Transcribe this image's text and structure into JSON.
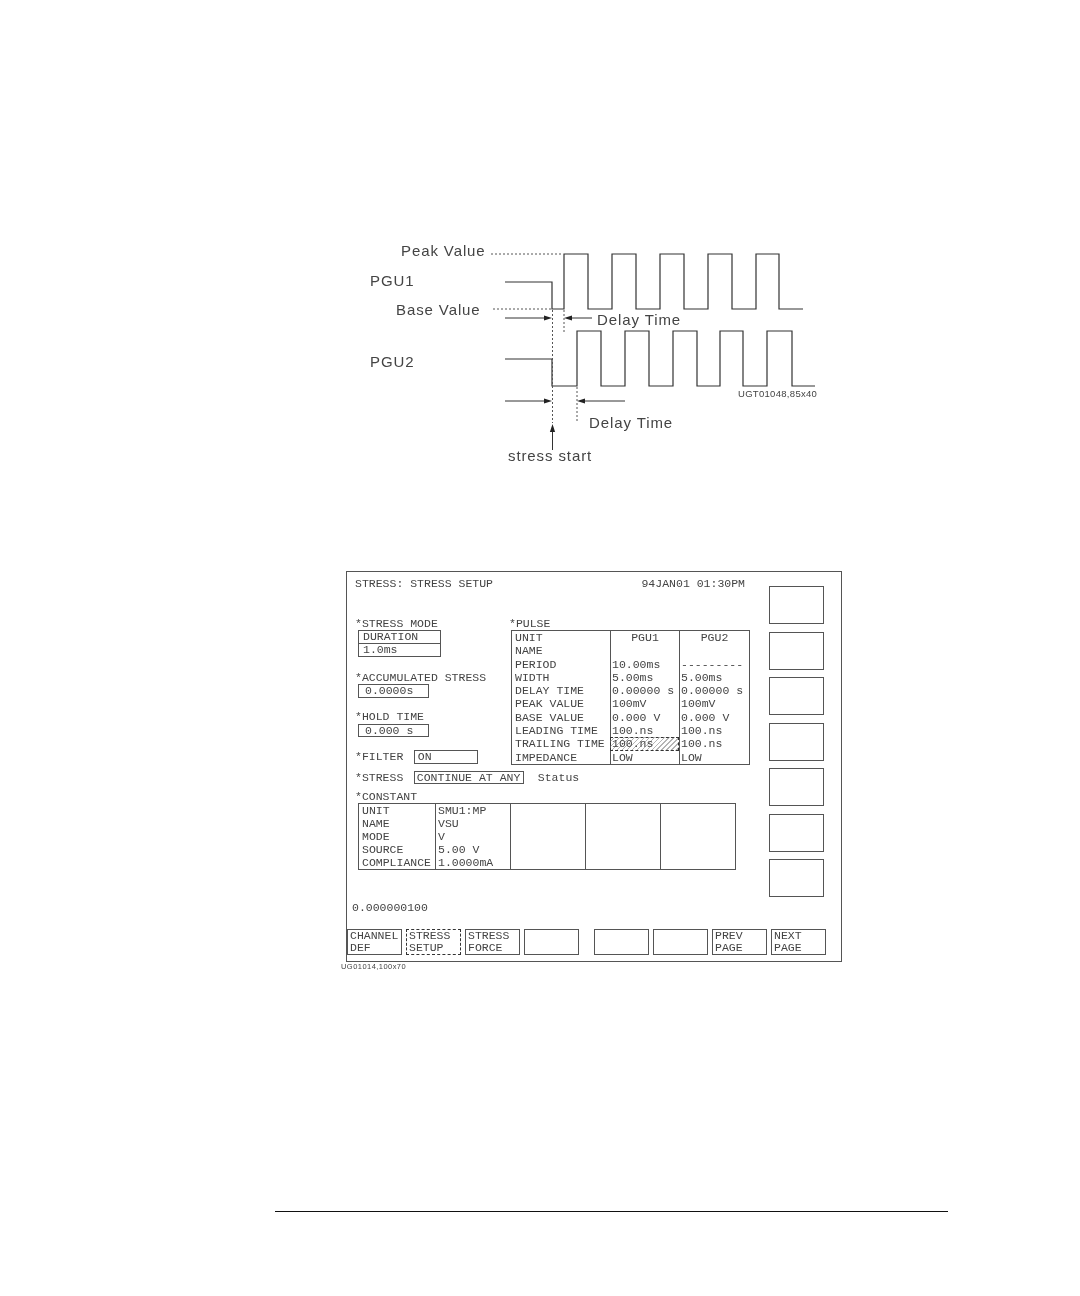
{
  "timing_diagram": {
    "peak_label": "Peak Value",
    "base_label": "Base Value",
    "channels": [
      {
        "name": "PGU1",
        "delay_label": "Delay Time"
      },
      {
        "name": "PGU2",
        "delay_label": "Delay Time"
      }
    ],
    "start_label": "stress start",
    "figure_id": "UGT01048,85x40"
  },
  "screen": {
    "title": "STRESS: STRESS SETUP",
    "datetime": "94JAN01 01:30PM",
    "stress_mode": {
      "label": "*STRESS MODE",
      "values": [
        "DURATION",
        "1.0ms"
      ]
    },
    "accumulated_stress": {
      "label": "*ACCUMULATED STRESS",
      "value": "0.0000s"
    },
    "hold_time": {
      "label": "*HOLD TIME",
      "value": "0.000 s"
    },
    "filter": {
      "label": "*FILTER",
      "value": "ON"
    },
    "pulse": {
      "label": "*PULSE",
      "columns": [
        "UNIT",
        "PGU1",
        "PGU2"
      ],
      "rows": [
        {
          "label": "NAME"
        },
        {
          "label": "PERIOD",
          "values": [
            {
              "text": "10.00ms",
              "selected": false
            },
            {
              "text": "---------",
              "selected": false
            }
          ]
        },
        {
          "label": "WIDTH",
          "values": [
            {
              "text": "5.00ms",
              "selected": false
            },
            {
              "text": "5.00ms",
              "selected": false
            }
          ]
        },
        {
          "label": "DELAY TIME",
          "values": [
            {
              "text": "0.00000 s",
              "selected": false
            },
            {
              "text": "0.00000 s",
              "selected": false
            }
          ]
        },
        {
          "label": "PEAK VALUE",
          "values": [
            {
              "text": "100mV",
              "selected": false
            },
            {
              "text": "100mV",
              "selected": false
            }
          ]
        },
        {
          "label": "BASE VALUE",
          "values": [
            {
              "text": "0.000 V",
              "selected": false
            },
            {
              "text": "0.000 V",
              "selected": false
            }
          ]
        },
        {
          "label": "LEADING TIME",
          "values": [
            {
              "text": "100.ns",
              "selected": false
            },
            {
              "text": "100.ns",
              "selected": false
            }
          ]
        },
        {
          "label": "TRAILING TIME",
          "values": [
            {
              "text": "100.ns",
              "selected": true
            },
            {
              "text": "100.ns",
              "selected": false
            }
          ]
        },
        {
          "label": "IMPEDANCE",
          "values": [
            {
              "text": "LOW",
              "selected": false
            },
            {
              "text": "LOW",
              "selected": false
            }
          ]
        }
      ]
    },
    "stress": {
      "label": "*STRESS",
      "value": "CONTINUE AT ANY",
      "note": "Status"
    },
    "constant": {
      "label": "*CONSTANT",
      "rows": [
        "UNIT",
        "NAME",
        "MODE",
        "SOURCE",
        "COMPLIANCE"
      ],
      "columns": [
        {
          "kind": "channel",
          "values": [
            "SMU1:MP",
            "VSU",
            "V",
            "5.00 V",
            "1.0000mA"
          ]
        },
        {
          "kind": "empty"
        },
        {
          "kind": "empty"
        },
        {
          "kind": "empty"
        }
      ]
    },
    "entry": "0.000000100",
    "side_keys": [
      {
        "kind": "blank"
      },
      {
        "kind": "blank"
      },
      {
        "kind": "blank"
      },
      {
        "kind": "blank"
      },
      {
        "kind": "blank"
      },
      {
        "kind": "blank"
      },
      {
        "kind": "blank"
      }
    ],
    "softkeys": [
      {
        "lines": [
          "CHANNEL",
          "DEF"
        ],
        "selected": false
      },
      {
        "lines": [
          "STRESS",
          "SETUP"
        ],
        "selected": true
      },
      {
        "lines": [
          "STRESS",
          "FORCE"
        ],
        "selected": false
      },
      {
        "selected": false
      },
      {
        "selected": false
      },
      {
        "selected": false
      },
      {
        "lines": [
          "PREV",
          "PAGE"
        ],
        "selected": false
      },
      {
        "lines": [
          "NEXT",
          "PAGE"
        ],
        "selected": false
      }
    ]
  },
  "figure_id": "UG01014,100x70"
}
